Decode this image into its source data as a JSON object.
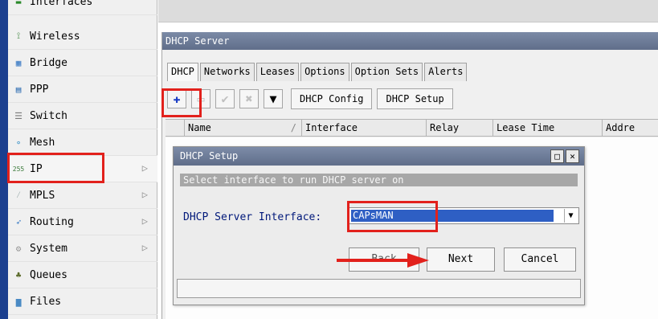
{
  "sidebar": {
    "items": [
      {
        "label": "Interfaces",
        "icon": "interfaces-icon"
      },
      {
        "label": "Wireless",
        "icon": "wireless-icon"
      },
      {
        "label": "Bridge",
        "icon": "bridge-icon"
      },
      {
        "label": "PPP",
        "icon": "ppp-icon"
      },
      {
        "label": "Switch",
        "icon": "switch-icon"
      },
      {
        "label": "Mesh",
        "icon": "mesh-icon"
      },
      {
        "label": "IP",
        "icon": "ip-icon",
        "submenu": true
      },
      {
        "label": "MPLS",
        "icon": "mpls-icon",
        "submenu": true
      },
      {
        "label": "Routing",
        "icon": "routing-icon",
        "submenu": true
      },
      {
        "label": "System",
        "icon": "system-icon",
        "submenu": true
      },
      {
        "label": "Queues",
        "icon": "queues-icon"
      },
      {
        "label": "Files",
        "icon": "files-icon"
      }
    ]
  },
  "window": {
    "title": "DHCP Server",
    "tabs": [
      "DHCP",
      "Networks",
      "Leases",
      "Options",
      "Option Sets",
      "Alerts"
    ],
    "toolbar": {
      "add_symbol": "✚",
      "remove_symbol": "▭",
      "enable_symbol": "✔",
      "disable_symbol": "✖",
      "filter_symbol": "▼",
      "dhcp_config": "DHCP Config",
      "dhcp_setup": "DHCP Setup"
    },
    "columns": [
      "Name",
      "Interface",
      "Relay",
      "Lease Time",
      "Addre"
    ],
    "sort_marker": "/"
  },
  "dialog": {
    "title": "DHCP Setup",
    "message": "Select interface to run DHCP server on",
    "field_label": "DHCP Server Interface:",
    "field_value": "CAPsMAN",
    "back_label": "Back",
    "next_label": "Next",
    "cancel_label": "Cancel",
    "maximize_symbol": "□",
    "close_symbol": "✕",
    "dropdown_symbol": "▼"
  },
  "colors": {
    "highlight": "#e2211c",
    "title_bar": "#6b7a96",
    "selection": "#2e5fc4"
  }
}
